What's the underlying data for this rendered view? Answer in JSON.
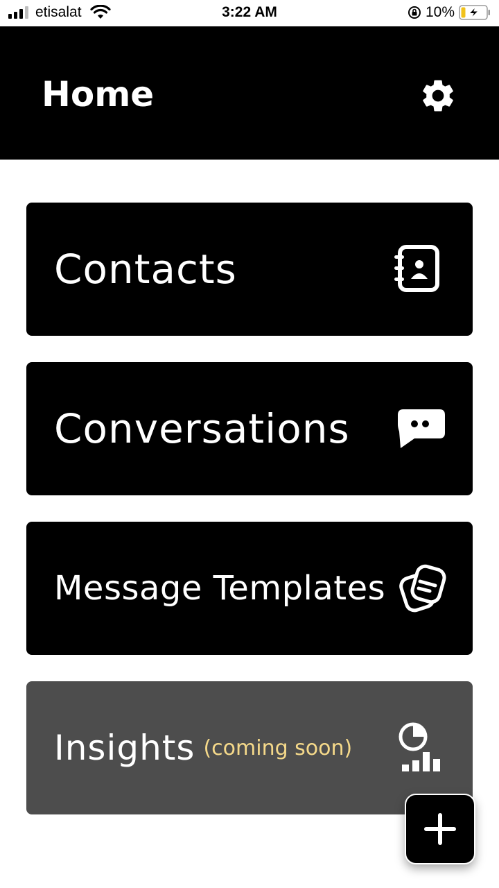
{
  "status_bar": {
    "carrier": "etisalat",
    "time": "3:22 AM",
    "battery": "10%",
    "icons": [
      "signal-icon",
      "wifi-icon",
      "orientation-lock-icon",
      "battery-charging-icon"
    ]
  },
  "header": {
    "title": "Home",
    "settings_icon": "gear-icon"
  },
  "menu": [
    {
      "label": "Contacts",
      "icon": "contact-book-icon"
    },
    {
      "label": "Conversations",
      "icon": "chat-bubble-icon"
    },
    {
      "label": "Message Templates",
      "icon": "templates-icon"
    },
    {
      "label": "Insights",
      "badge": "(coming soon)",
      "icon": "insights-chart-icon"
    }
  ],
  "fab": {
    "icon": "plus-icon"
  },
  "colors": {
    "primary": "#000000",
    "disabled_card": "#4d4d4d",
    "badge_text": "#f5d98a",
    "background": "#ffffff"
  }
}
